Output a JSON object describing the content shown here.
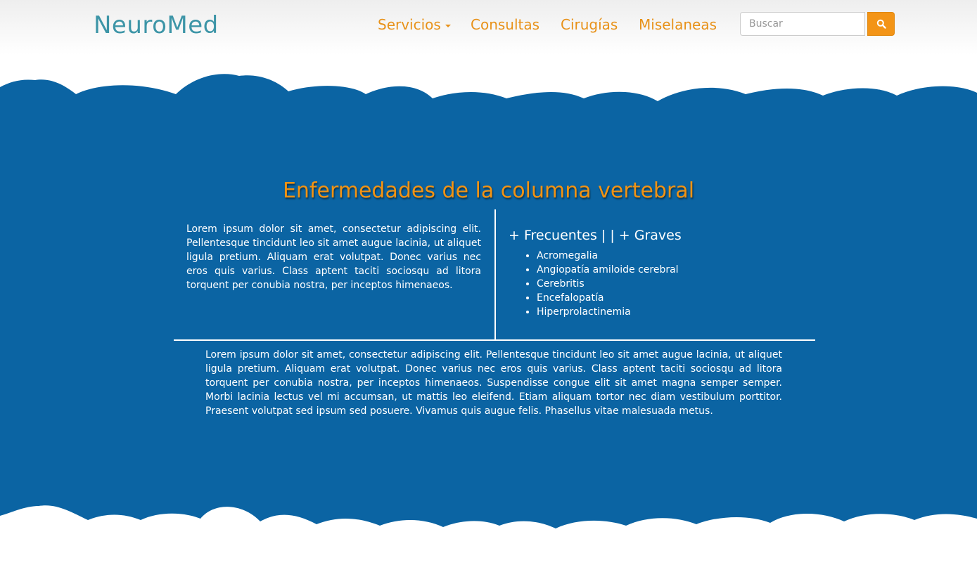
{
  "navbar": {
    "brand": "NeuroMed",
    "items": [
      {
        "label": "Servicios",
        "has_dropdown": true
      },
      {
        "label": "Consultas",
        "has_dropdown": false
      },
      {
        "label": "Cirugías",
        "has_dropdown": false
      },
      {
        "label": "Miselaneas",
        "has_dropdown": false
      }
    ],
    "search": {
      "placeholder": "Buscar",
      "value": "",
      "button_icon": "search-icon"
    }
  },
  "main": {
    "title": "Enfermedades de la columna vertebral",
    "left_paragraph": "Lorem ipsum dolor sit amet, consectetur adipiscing elit. Pellentesque tincidunt leo sit amet augue lacinia, ut aliquet ligula pretium. Aliquam erat volutpat. Donec varius nec eros quis varius. Class aptent taciti sociosqu ad litora torquent per conubia nostra, per inceptos himenaeos.",
    "list_heading": "+ Frecuentes | | + Graves",
    "diseases": [
      "Acromegalia",
      "Angiopatía amiloide cerebral",
      "Cerebritis",
      "Encefalopatía",
      "Hiperprolactinemia"
    ],
    "bottom_paragraph": "Lorem ipsum dolor sit amet, consectetur adipiscing elit. Pellentesque tincidunt leo sit amet augue lacinia, ut aliquet ligula pretium. Aliquam erat volutpat. Donec varius nec eros quis varius. Class aptent taciti sociosqu ad litora torquent per conubia nostra, per inceptos himenaeos. Suspendisse congue elit sit amet magna semper semper. Morbi lacinia lectus vel mi accumsan, ut mattis leo eleifend. Etiam aliquam tortor nec diam vestibulum porttitor. Praesent volutpat sed ipsum sed posuere. Vivamus quis augue felis. Phasellus vitae malesuada metus."
  },
  "colors": {
    "brand": "#3d95a7",
    "accent_orange": "#f29313",
    "section_blue": "#0b64a3",
    "text_white": "#ffffff"
  }
}
